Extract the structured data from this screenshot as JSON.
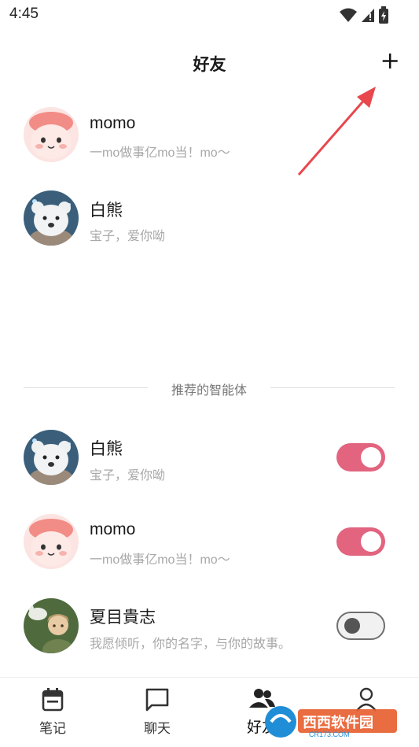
{
  "status_bar": {
    "time": "4:45"
  },
  "header": {
    "title": "好友"
  },
  "friends": [
    {
      "name": "momo",
      "subtitle": "一mo做事亿mo当！mo～"
    },
    {
      "name": "白熊",
      "subtitle": "宝子，爱你呦"
    }
  ],
  "recommended": {
    "label": "推荐的智能体",
    "items": [
      {
        "name": "白熊",
        "subtitle": "宝子，爱你呦",
        "enabled": true
      },
      {
        "name": "momo",
        "subtitle": "一mo做事亿mo当！mo～",
        "enabled": true
      },
      {
        "name": "夏目貴志",
        "subtitle": "我愿倾听，你的名字，与你的故事。",
        "enabled": false
      }
    ]
  },
  "tabs": [
    {
      "label": "笔记",
      "icon": "calendar-icon"
    },
    {
      "label": "聊天",
      "icon": "chat-bubble-icon"
    },
    {
      "label": "好友",
      "icon": "people-icon",
      "active": true
    },
    {
      "label": "",
      "icon": "person-icon"
    }
  ],
  "watermark": {
    "text": "西西软件园",
    "sub": "CR173.COM"
  },
  "colors": {
    "accent": "#e2647f",
    "arrow": "#e8474e",
    "muted_text": "#a8a8a8"
  }
}
